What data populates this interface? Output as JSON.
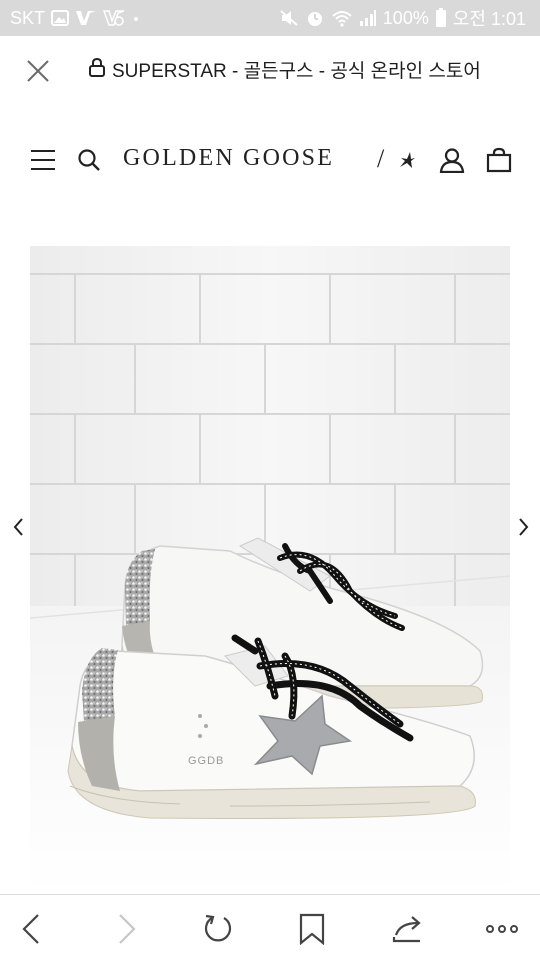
{
  "status_bar": {
    "carrier": "SKT",
    "battery": "100%",
    "time": "오전 1:01",
    "icons": [
      "image-icon",
      "v-logo-icon",
      "v-logo-outline-icon",
      "dot-icon",
      "mute-icon",
      "alarm-icon",
      "wifi-icon",
      "signal-icon",
      "battery-icon"
    ]
  },
  "browser": {
    "page_title": "SUPERSTAR - 골든구스 - 공식 온라인 스토어",
    "secure": true
  },
  "site_header": {
    "brand": "GOLDEN GOOSE",
    "slash": "/",
    "icons": [
      "menu-icon",
      "search-icon",
      "star-icon",
      "account-icon",
      "bag-icon"
    ]
  },
  "gallery": {
    "image": "white leather sneakers with silver glitter heel and silver star, black laces",
    "shoe_text": "GGDB"
  },
  "bottom_nav": {
    "items": [
      "back-icon",
      "forward-icon",
      "refresh-icon",
      "bookmark-icon",
      "share-icon",
      "more-icon"
    ]
  },
  "colors": {
    "status_bar_bg": "#d9d9d9",
    "text": "#1e1e1e",
    "tile": "#f2f2f2",
    "glitter": "#b9b9b9"
  }
}
